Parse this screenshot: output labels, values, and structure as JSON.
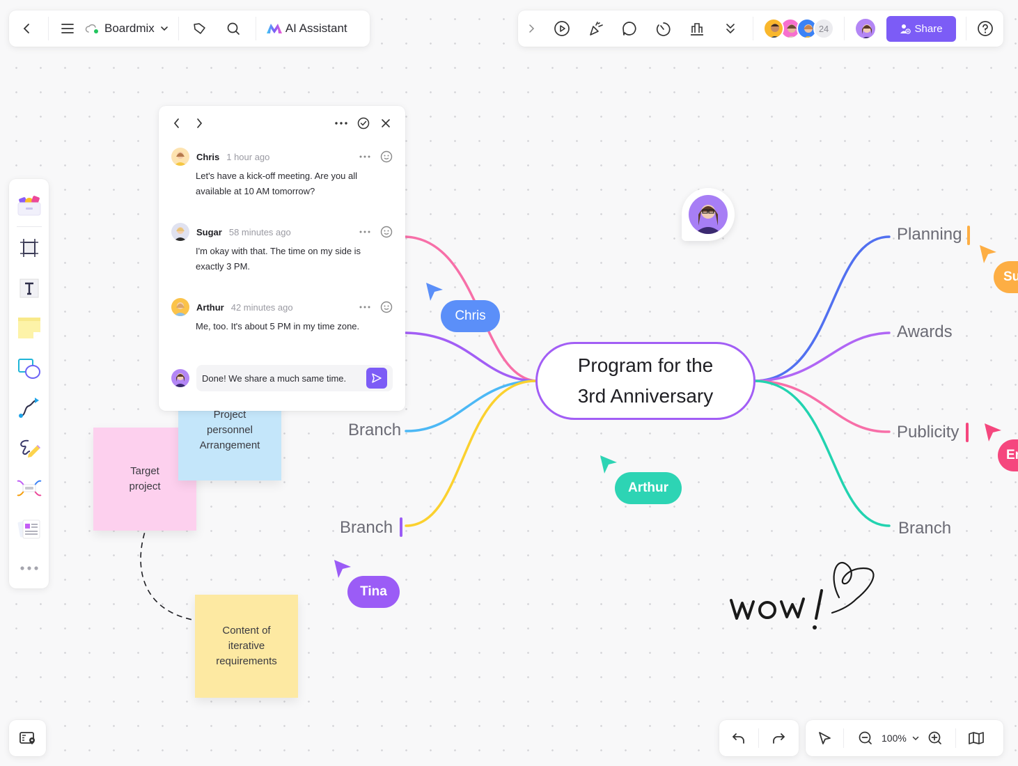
{
  "toolbar_left": {
    "back_icon": "chevron-left-icon",
    "menu_icon": "hamburger-menu-icon",
    "board_name": "Boardmix",
    "sync_status_color": "#22c55e",
    "tag_icon": "tag-icon",
    "search_icon": "search-icon",
    "ai_label": "AI Assistant"
  },
  "toolbar_right": {
    "tools": [
      "expand-chevron",
      "present",
      "celebrate",
      "comment",
      "timer",
      "vote",
      "more"
    ],
    "collaborator_count": "24",
    "share_label": "Share",
    "accent": "#7c5cf6"
  },
  "sidebar": {
    "tools": [
      "templates",
      "frame",
      "text",
      "sticky-note",
      "shapes",
      "connector",
      "pen",
      "mind-map",
      "docs",
      "more"
    ]
  },
  "comments": {
    "items": [
      {
        "author": "Chris",
        "time": "1 hour ago",
        "body": "Let's have a kick-off meeting. Are you all available at 10 AM tomorrow?"
      },
      {
        "author": "Sugar",
        "time": "58 minutes ago",
        "body": "I'm okay with that. The time on my side is exactly 3 PM."
      },
      {
        "author": "Arthur",
        "time": "42 minutes ago",
        "body": "Me, too. It's about 5 PM in my time zone."
      }
    ],
    "reply_text": "Done! We share a much same time."
  },
  "stickies": [
    {
      "text": "Target\nproject",
      "color": "#fdd0ee"
    },
    {
      "text": "Project\npersonnel\nArrangement",
      "color": "#c4e6fa"
    },
    {
      "text": "Content of\niterative\nrequirements",
      "color": "#fde9a2"
    }
  ],
  "mindmap": {
    "root": "Program for the\n3rd Anniversary",
    "left_branches": [
      {
        "label": "",
        "color": "#f76fa8"
      },
      {
        "label": "",
        "color": "#a25ef5"
      },
      {
        "label": "Branch",
        "color": "#4cb8f5"
      },
      {
        "label": "Branch",
        "color": "#fbd12f"
      }
    ],
    "right_branches": [
      {
        "label": "Planning",
        "color": "#5170f0"
      },
      {
        "label": "Awards",
        "color": "#b066f5"
      },
      {
        "label": "Publicity",
        "color": "#f76fa8"
      },
      {
        "label": "Branch",
        "color": "#22d3b0"
      }
    ]
  },
  "cursors": [
    {
      "name": "Chris",
      "color": "#5b8ff9"
    },
    {
      "name": "Arthur",
      "color": "#2dd4b4"
    },
    {
      "name": "Tina",
      "color": "#9b5cf6"
    },
    {
      "name": "Su",
      "color": "#fdae44"
    },
    {
      "name": "Em",
      "color": "#f5477e"
    }
  ],
  "handwriting": "wow!",
  "zoom": {
    "level": "100%"
  }
}
